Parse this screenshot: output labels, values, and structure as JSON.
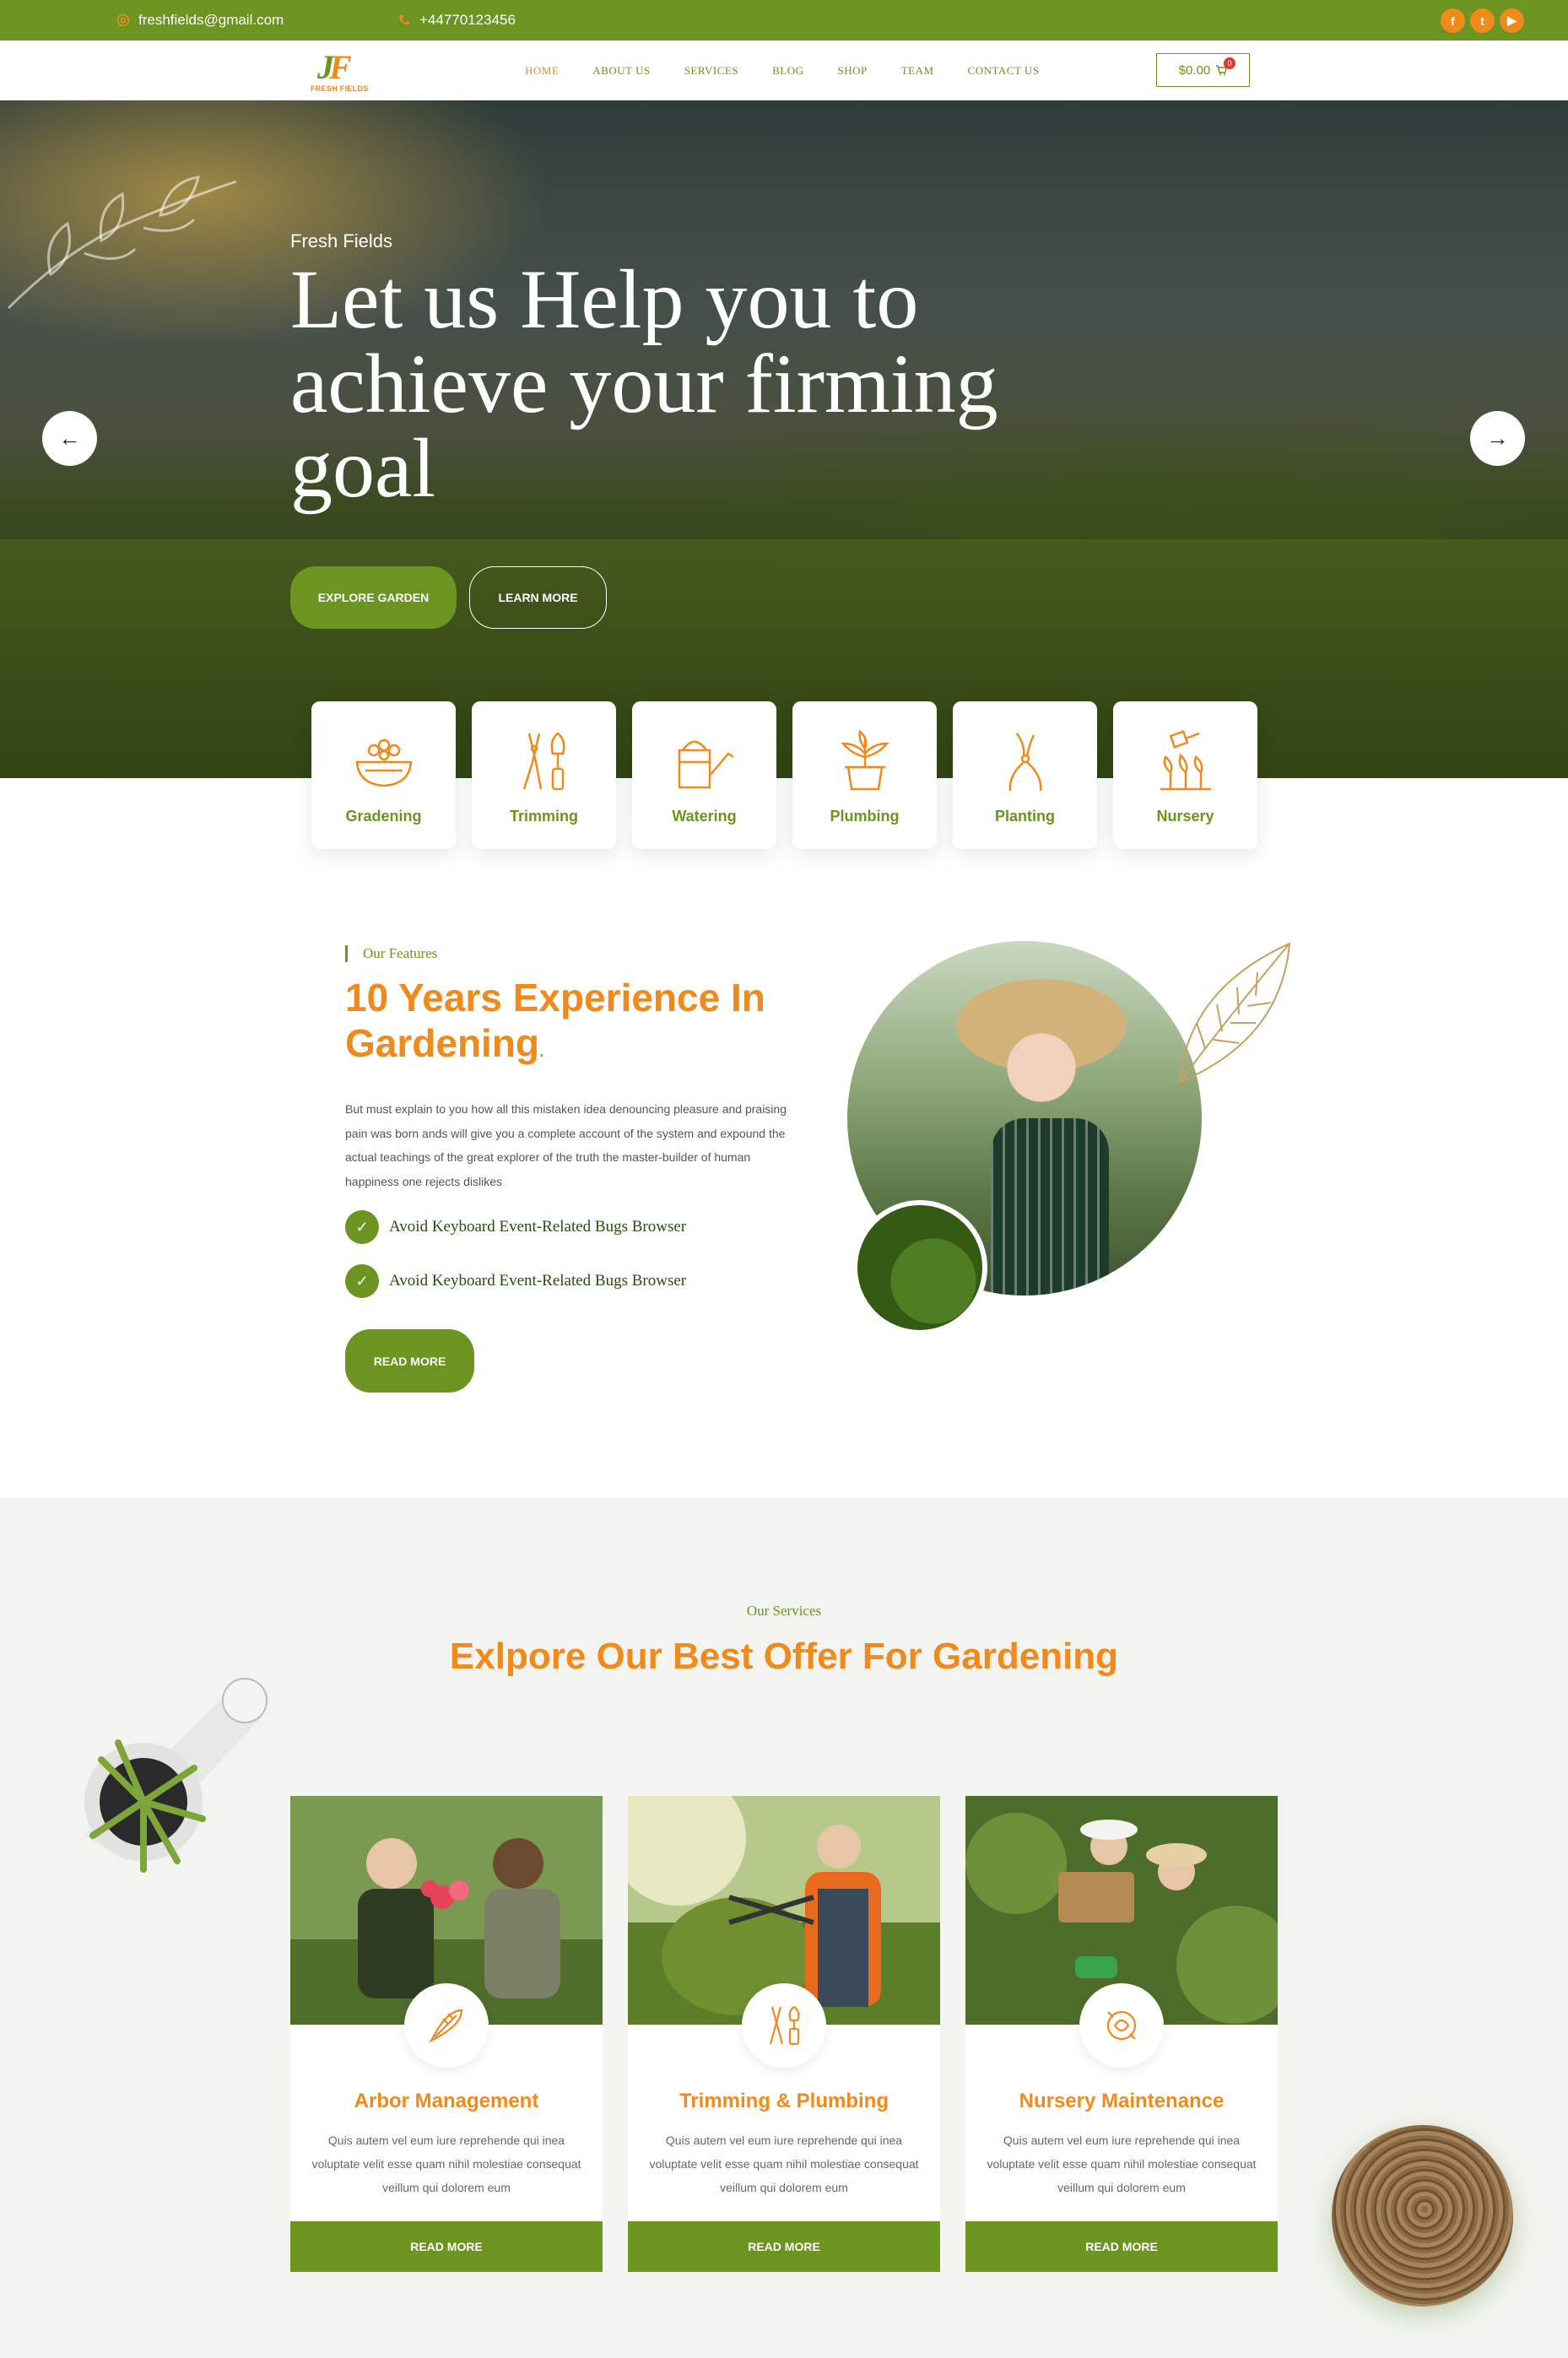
{
  "topbar": {
    "email": "freshfields@gmail.com",
    "phone": "+44770123456",
    "socials": [
      "facebook-icon",
      "twitter-icon",
      "youtube-icon"
    ]
  },
  "header": {
    "logo_mark": "JF",
    "logo_brand": "FRESH FIELDS",
    "nav": [
      "HOME",
      "ABOUT US",
      "SERVICES",
      "BLOG",
      "SHOP",
      "TEAM",
      "CONTACT US"
    ],
    "active_nav": "HOME",
    "cart_total": "$0.00",
    "cart_count": "0"
  },
  "hero": {
    "eyebrow": "Fresh Fields",
    "title": "Let us Help you to achieve your firming goal",
    "primary_button": "EXPLORE GARDEN",
    "secondary_button": "LEARN MORE"
  },
  "features": [
    {
      "label": "Gradening",
      "icon": "flower-basket-icon"
    },
    {
      "label": "Trimming",
      "icon": "shears-trowel-icon"
    },
    {
      "label": "Watering",
      "icon": "watering-can-icon"
    },
    {
      "label": "Plumbing",
      "icon": "potted-plant-icon"
    },
    {
      "label": "Planting",
      "icon": "pruner-icon"
    },
    {
      "label": "Nursery",
      "icon": "seedlings-icon"
    }
  ],
  "about": {
    "eyebrow": "Our Features",
    "title": "10 Years Experience In Gardening",
    "title_suffix": ".",
    "text": "But must explain to you how all this mistaken idea denouncing pleasure and praising pain was born ands will give you a complete account of the system and expound the actual teachings of the great explorer of the truth the master-builder of human happiness one rejects dislikes",
    "checks": [
      "Avoid Keyboard Event-Related Bugs Browser",
      "Avoid Keyboard Event-Related Bugs Browser"
    ],
    "button": "READ MORE"
  },
  "services": {
    "eyebrow": "Our Services",
    "title": "Exlpore Our Best Offer For Gardening",
    "cards": [
      {
        "title": "Arbor Management",
        "desc": "Quis autem vel eum iure reprehende qui inea voluptate velit esse quam nihil molestiae consequat veillum qui dolorem eum",
        "button": "READ MORE"
      },
      {
        "title": "Trimming & Plumbing",
        "desc": "Quis autem vel eum iure reprehende qui inea voluptate velit esse quam nihil molestiae consequat veillum qui dolorem eum",
        "button": "READ MORE"
      },
      {
        "title": "Nursery Maintenance",
        "desc": "Quis autem vel eum iure reprehende qui inea voluptate velit esse quam nihil molestiae consequat veillum qui dolorem eum",
        "button": "READ MORE"
      }
    ]
  },
  "colors": {
    "green": "#6b9420",
    "orange": "#f08a1c",
    "section_bg": "#f3f4f0"
  }
}
